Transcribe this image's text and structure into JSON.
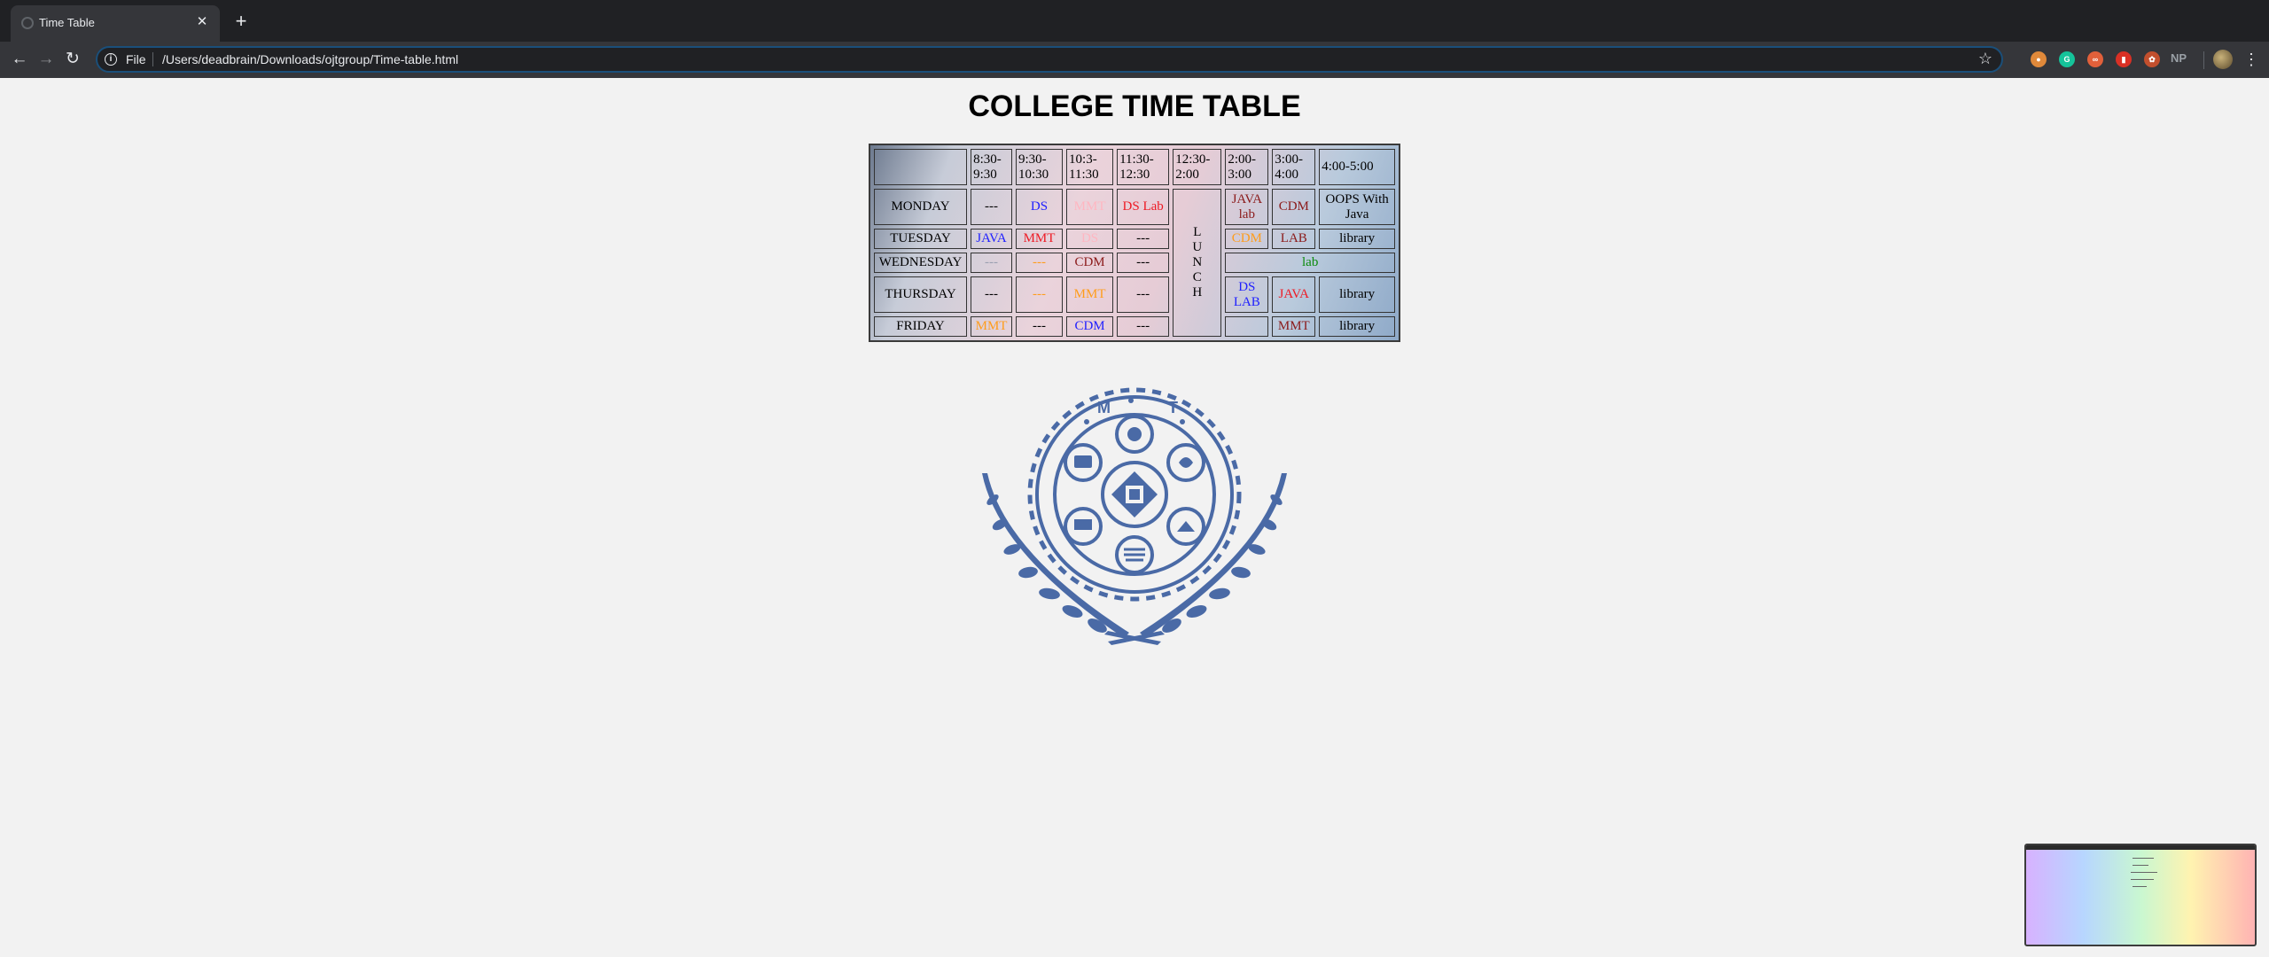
{
  "browser": {
    "tab_title": "Time Table",
    "address_scheme": "File",
    "url": "/Users/deadbrain/Downloads/ojtgroup/Time-table.html",
    "extensions": [
      "np-extension"
    ],
    "extension_np_label": "NP"
  },
  "icons": {
    "favicon": "globe-icon",
    "tab_close": "close-icon",
    "new_tab": "plus-icon",
    "back": "arrow-left-icon",
    "forward": "arrow-right-icon",
    "reload": "reload-icon",
    "site_info": "info-icon",
    "bookmark": "star-icon",
    "menu": "kebab-icon"
  },
  "page": {
    "title": "COLLEGE TIME TABLE"
  },
  "timetable": {
    "header": [
      "",
      "8:30-9:30",
      "9:30-10:30",
      "10:3-11:30",
      "11:30-12:30",
      "12:30-2:00",
      "2:00-3:00",
      "3:00-4:00",
      "4:00-5:00"
    ],
    "lunch_letters": [
      "L",
      "U",
      "N",
      "C",
      "H"
    ],
    "days": [
      "MONDAY",
      "TUESDAY",
      "WEDNESDAY",
      "THURSDAY",
      "FRIDAY"
    ],
    "rows": {
      "monday": [
        "---",
        "DS",
        "MMT",
        "DS Lab",
        "JAVA lab",
        "CDM",
        "OOPS With Java"
      ],
      "tuesday": [
        "JAVA",
        "MMT",
        "DS",
        "---",
        "CDM",
        "LAB",
        "library"
      ],
      "wednesday": [
        "---",
        "---",
        "CDM",
        "---",
        "lab"
      ],
      "thursday": [
        "---",
        "---",
        "MMT",
        "---",
        "DS LAB",
        "JAVA",
        "library"
      ],
      "friday": [
        "MMT",
        "---",
        "CDM",
        "---",
        "",
        "MMT",
        "library"
      ]
    }
  },
  "colors": {
    "page_background": "#f2f2f2",
    "blue_text": "#1f1fff",
    "red_text": "#ee1a24",
    "maroon_text": "#8b1a1a",
    "pink_text": "#ffb6c1",
    "orange_text": "#ff9c1a",
    "green_text": "#0a8a0a",
    "logo_blue": "#4a6aa6"
  },
  "logo": {
    "icon": "mit-college-emblem"
  }
}
